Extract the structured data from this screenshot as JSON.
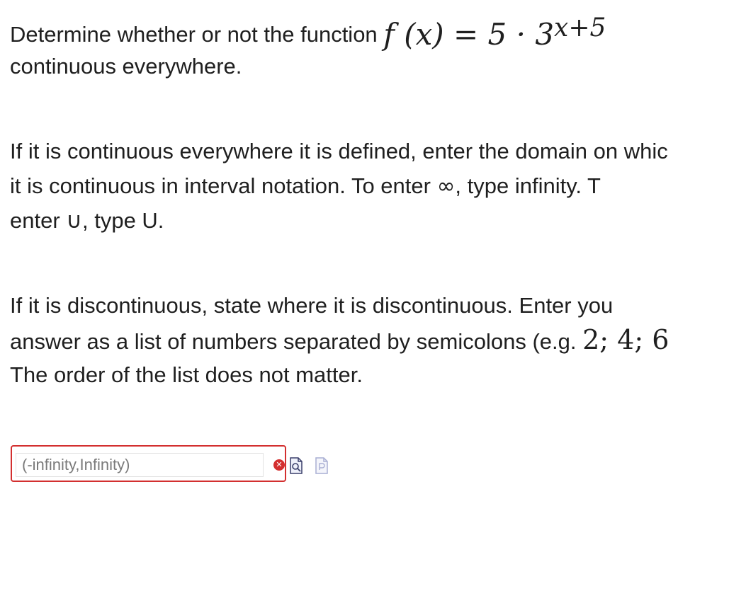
{
  "question": {
    "p1_pre": "Determine whether or not the function ",
    "p1_fx_lhs": "f (x) = 5 · 3",
    "p1_fx_exp": "x+5",
    "p1_line2": "continuous everywhere.",
    "p2_l1": "If it is continuous everywhere it is defined, enter the domain on whic",
    "p2_l2_a": "it  is  continuous  in  interval  notation.  To  enter ",
    "p2_l2_sym": "∞",
    "p2_l2_b": ",  type  infinity.  T",
    "p2_l3_a": "enter ",
    "p2_l3_sym": "∪",
    "p2_l3_b": ", type U.",
    "p3_l1": "If  it  is  discontinuous,  state  where  it  is  discontinuous.  Enter  you",
    "p3_l2_a": "answer as a list of numbers separated by semicolons (e.g. ",
    "p3_l2_nums": "2; 4; 6",
    "p3_l3": "The order of the list does not matter."
  },
  "answer": {
    "value": "(-infinity,Infinity)",
    "status": "incorrect",
    "error_icon": "x-circle-icon",
    "error_symbol": "✕",
    "accent": "#d32f2f"
  },
  "icons": {
    "preview": "preview-icon",
    "syntax_help": "syntax-help-icon"
  }
}
